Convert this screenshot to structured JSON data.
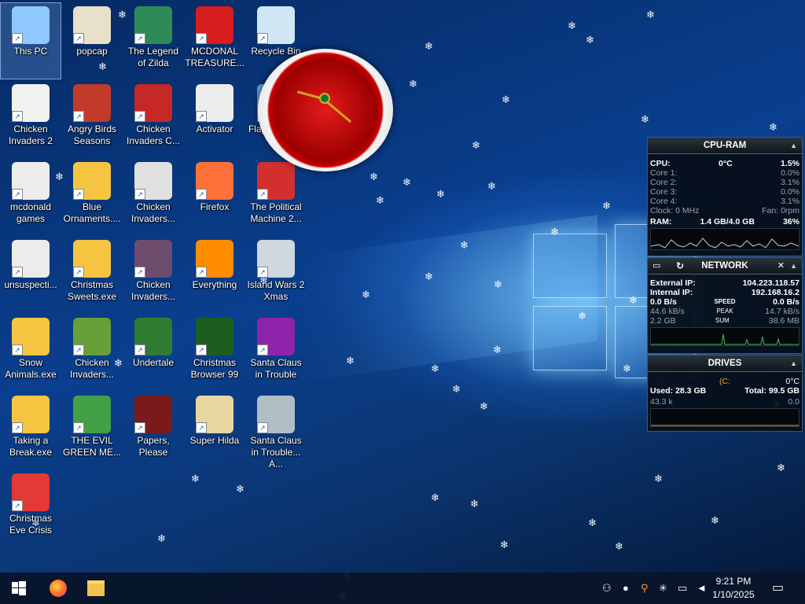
{
  "desktop": {
    "icons": [
      {
        "label": "This PC",
        "icon": "this-pc-icon",
        "color": "#8fc8ff",
        "selected": true
      },
      {
        "label": "popcap",
        "icon": "popcap-folder-icon",
        "color": "#e8e0c8"
      },
      {
        "label": "The Legend of Zilda",
        "icon": "legend-zilda-icon",
        "color": "#2e8b57"
      },
      {
        "label": "MCDONAL TREASURE...",
        "icon": "mcdonald-treasure-icon",
        "color": "#d71d1d"
      },
      {
        "label": "Recycle Bin",
        "icon": "recycle-bin-icon",
        "color": "#cfe6f5"
      },
      {
        "label": "Chicken Invaders 2",
        "icon": "chicken-invaders-2-icon",
        "color": "#f2f2f2"
      },
      {
        "label": "Angry Birds Seasons",
        "icon": "angry-birds-seasons-icon",
        "color": "#c23a2a"
      },
      {
        "label": "Chicken Invaders C...",
        "icon": "chicken-invaders-christmas-icon",
        "color": "#c62828"
      },
      {
        "label": "Activator",
        "icon": "activator-folder-icon",
        "color": "#ececec"
      },
      {
        "label": "Flappy Plane",
        "icon": "flappy-plane-icon",
        "color": "#6aa0d8"
      },
      {
        "label": "mcdonald games",
        "icon": "mcdonald-games-folder-icon",
        "color": "#ececec"
      },
      {
        "label": "Blue Ornaments....",
        "icon": "blue-ornaments-icon",
        "color": "#f5c542"
      },
      {
        "label": "Chicken Invaders...",
        "icon": "chicken-invaders-3-icon",
        "color": "#e0e0e0"
      },
      {
        "label": "Firefox",
        "icon": "firefox-icon",
        "color": "#ff7139"
      },
      {
        "label": "The Political Machine 2...",
        "icon": "political-machine-icon",
        "color": "#d32f2f"
      },
      {
        "label": "unsuspecti...",
        "icon": "unsuspecting-folder-icon",
        "color": "#ececec"
      },
      {
        "label": "Christmas Sweets.exe",
        "icon": "christmas-sweets-icon",
        "color": "#f5c542"
      },
      {
        "label": "Chicken Invaders...",
        "icon": "chicken-invaders-4-icon",
        "color": "#6d4c6d"
      },
      {
        "label": "Everything",
        "icon": "everything-search-icon",
        "color": "#ff8c00"
      },
      {
        "label": "Island Wars 2 Xmas",
        "icon": "island-wars-icon",
        "color": "#cfd8dc"
      },
      {
        "label": "Snow Animals.exe",
        "icon": "snow-animals-icon",
        "color": "#f5c542"
      },
      {
        "label": "Chicken Invaders...",
        "icon": "chicken-invaders-5-icon",
        "color": "#689f38"
      },
      {
        "label": "Undertale",
        "icon": "undertale-icon",
        "color": "#2e7d32"
      },
      {
        "label": "Christmas Browser 99",
        "icon": "christmas-browser-icon",
        "color": "#1b5e20"
      },
      {
        "label": "Santa Claus in Trouble",
        "icon": "santa-trouble-icon",
        "color": "#8e24aa"
      },
      {
        "label": "Taking a Break.exe",
        "icon": "taking-a-break-icon",
        "color": "#f5c542"
      },
      {
        "label": "THE EVIL GREEN ME...",
        "icon": "evil-green-messenger-icon",
        "color": "#43a047"
      },
      {
        "label": "Papers, Please",
        "icon": "papers-please-icon",
        "color": "#7a1a1a"
      },
      {
        "label": "Super Hilda",
        "icon": "super-hilda-icon",
        "color": "#e8d6a0"
      },
      {
        "label": "Santa Claus in Trouble... A...",
        "icon": "santa-trouble-again-icon",
        "color": "#b0bec5"
      },
      {
        "label": "Christmas Eve Crisis",
        "icon": "christmas-eve-crisis-icon",
        "color": "#e53935"
      }
    ]
  },
  "cpu_ram": {
    "title": "CPU-RAM",
    "cpu_label": "CPU:",
    "cpu_temp": "0°C",
    "cpu_pct": "1.5%",
    "cores": [
      {
        "label": "Core 1:",
        "value": "0.0%"
      },
      {
        "label": "Core 2:",
        "value": "3.1%"
      },
      {
        "label": "Core 3:",
        "value": "0.0%"
      },
      {
        "label": "Core 4:",
        "value": "3.1%"
      }
    ],
    "clock": "Clock: 0 MHz",
    "fan": "Fan: 0rpm",
    "ram_label": "RAM:",
    "ram_value": "1.4 GB/4.0 GB",
    "ram_pct": "36%"
  },
  "network": {
    "title": "NETWORK",
    "ext_label": "External IP:",
    "ext_ip": "104.223.118.57",
    "int_label": "Internal IP:",
    "int_ip": "192.168.16.2",
    "speed_down": "0.0 B/s",
    "speed_label": "SPEED",
    "speed_up": "0.0 B/s",
    "peak_down": "44.6 kB/s",
    "peak_label": "PEAK",
    "peak_up": "14.7 kB/s",
    "sum_down": "2.2 GB",
    "sum_label": "SUM",
    "sum_up": "38.6 MB"
  },
  "drives": {
    "title": "DRIVES",
    "drive": "(C:",
    "temp": "0°C",
    "used": "Used: 28.3 GB",
    "total": "Total: 99.5 GB",
    "read": "43.3 k",
    "write": "0.0"
  },
  "taskbar": {
    "time": "9:21 PM",
    "date": "1/10/2025"
  }
}
